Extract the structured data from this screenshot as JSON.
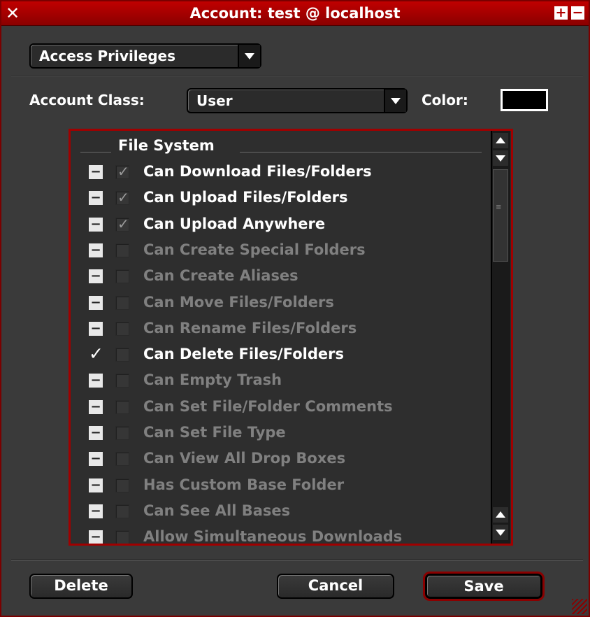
{
  "window": {
    "title": "Account: test @ localhost",
    "close_glyph": "✕",
    "plus_glyph": "+",
    "minus_glyph": "−"
  },
  "view_popup": {
    "selected": "Access Privileges"
  },
  "account_class": {
    "label": "Account Class:",
    "selected": "User"
  },
  "color": {
    "label": "Color:",
    "value": "#000000"
  },
  "group": {
    "title": "File System"
  },
  "privileges": [
    {
      "label": "Can Download Files/Folders",
      "enabled": true,
      "state": "inherit",
      "checked": true
    },
    {
      "label": "Can Upload Files/Folders",
      "enabled": true,
      "state": "inherit",
      "checked": true
    },
    {
      "label": "Can Upload Anywhere",
      "enabled": true,
      "state": "inherit",
      "checked": true
    },
    {
      "label": "Can Create Special Folders",
      "enabled": false,
      "state": "inherit",
      "checked": false
    },
    {
      "label": "Can Create Aliases",
      "enabled": false,
      "state": "inherit",
      "checked": false
    },
    {
      "label": "Can Move Files/Folders",
      "enabled": false,
      "state": "inherit",
      "checked": false
    },
    {
      "label": "Can Rename Files/Folders",
      "enabled": false,
      "state": "inherit",
      "checked": false
    },
    {
      "label": "Can Delete Files/Folders",
      "enabled": true,
      "state": "override",
      "checked": false
    },
    {
      "label": "Can Empty Trash",
      "enabled": false,
      "state": "inherit",
      "checked": false
    },
    {
      "label": "Can Set File/Folder Comments",
      "enabled": false,
      "state": "inherit",
      "checked": false
    },
    {
      "label": "Can Set File Type",
      "enabled": false,
      "state": "inherit",
      "checked": false
    },
    {
      "label": "Can View All Drop Boxes",
      "enabled": false,
      "state": "inherit",
      "checked": false
    },
    {
      "label": "Has Custom Base Folder",
      "enabled": false,
      "state": "inherit",
      "checked": false
    },
    {
      "label": "Can See All Bases",
      "enabled": false,
      "state": "inherit",
      "checked": false
    },
    {
      "label": "Allow Simultaneous Downloads",
      "enabled": false,
      "state": "inherit",
      "checked": false
    }
  ],
  "buttons": {
    "delete": "Delete",
    "cancel": "Cancel",
    "save": "Save"
  },
  "colors": {
    "accent": "#a00000",
    "background": "#3a3a3a",
    "enabled_text": "#ffffff",
    "disabled_text": "#808080"
  }
}
